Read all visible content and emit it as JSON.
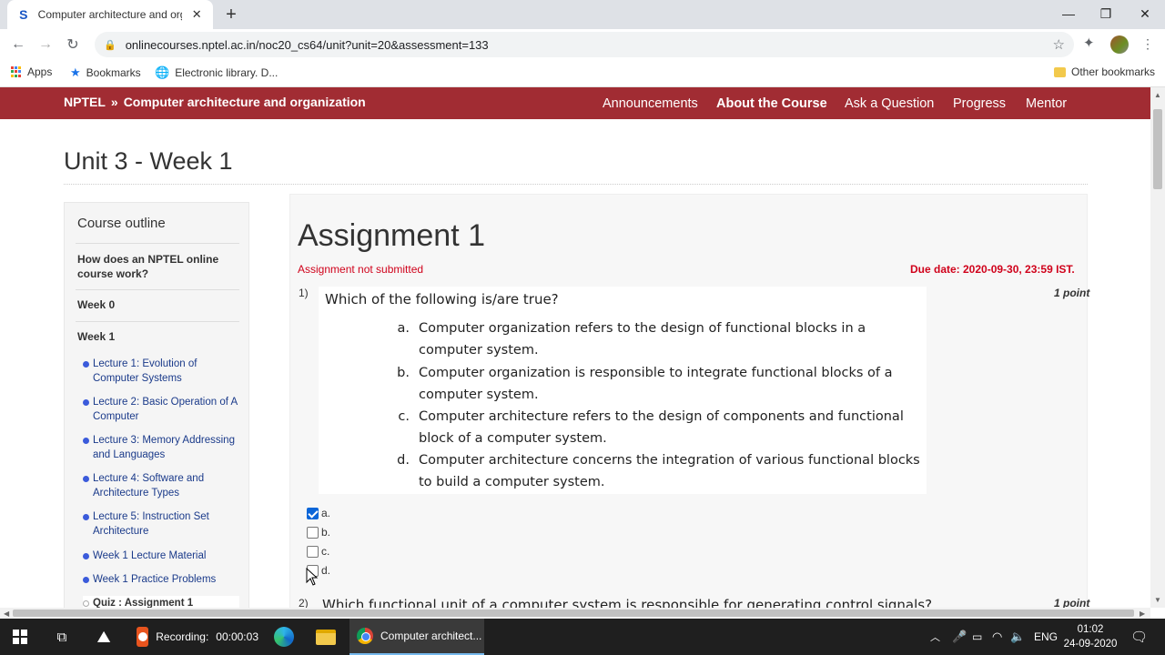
{
  "browser": {
    "tab_favicon": "S",
    "tab_title": "Computer architecture and organ",
    "url": "onlinecourses.nptel.ac.in/noc20_cs64/unit?unit=20&assessment=133",
    "icons": [
      "back-arrow-icon",
      "forward-arrow-icon",
      "reload-icon",
      "lock-icon",
      "star-icon",
      "puzzle-icon",
      "more-vert-icon"
    ]
  },
  "bookmarks": {
    "apps": "Apps",
    "bookmarks": "Bookmarks",
    "library": "Electronic library. D...",
    "other": "Other bookmarks"
  },
  "site": {
    "brand": "NPTEL",
    "separator": "»",
    "course": "Computer architecture and organization",
    "nav": [
      "Announcements",
      "About the Course",
      "Ask a Question",
      "Progress",
      "Mentor"
    ],
    "accent_color": "#a12c33"
  },
  "page": {
    "unit_title": "Unit 3 - Week 1"
  },
  "sidebar": {
    "heading": "Course outline",
    "sections": [
      "How does an NPTEL online course work?",
      "Week 0",
      "Week 1"
    ],
    "items": [
      "Lecture 1: Evolution of Computer Systems",
      "Lecture 2: Basic Operation of A Computer",
      "Lecture 3: Memory Addressing and Languages",
      "Lecture 4: Software and Architecture Types",
      "Lecture 5: Instruction Set Architecture",
      "Week 1 Lecture Material",
      "Week 1 Practice Problems",
      "Quiz : Assignment 1"
    ]
  },
  "assignment": {
    "title": "Assignment 1",
    "status": "Assignment not submitted",
    "due": "Due date: 2020-09-30, 23:59 IST.",
    "q1": {
      "number": "1)",
      "points": "1 point",
      "text": "Which of the following is/are true?",
      "options": [
        {
          "letter": "a.",
          "text": "Computer organization refers to the design of functional blocks in a computer system."
        },
        {
          "letter": "b.",
          "text": "Computer organization is responsible to integrate functional blocks of a computer system."
        },
        {
          "letter": "c.",
          "text": "Computer architecture refers to the design of components and functional block of a computer system."
        },
        {
          "letter": "d.",
          "text": "Computer architecture concerns the integration of various functional blocks to build a computer system."
        }
      ],
      "answers": [
        "a.",
        "b.",
        "c.",
        "d."
      ],
      "checked": [
        true,
        false,
        false,
        false
      ]
    },
    "q2": {
      "number": "2)",
      "points": "1 point",
      "text": "Which functional unit of a computer system is responsible for generating control signals?"
    }
  },
  "taskbar": {
    "recording": "Recording:",
    "recording_time": "00:00:03",
    "chrome_label": "Computer architect...",
    "lang": "ENG",
    "time": "01:02",
    "date": "24-09-2020"
  }
}
